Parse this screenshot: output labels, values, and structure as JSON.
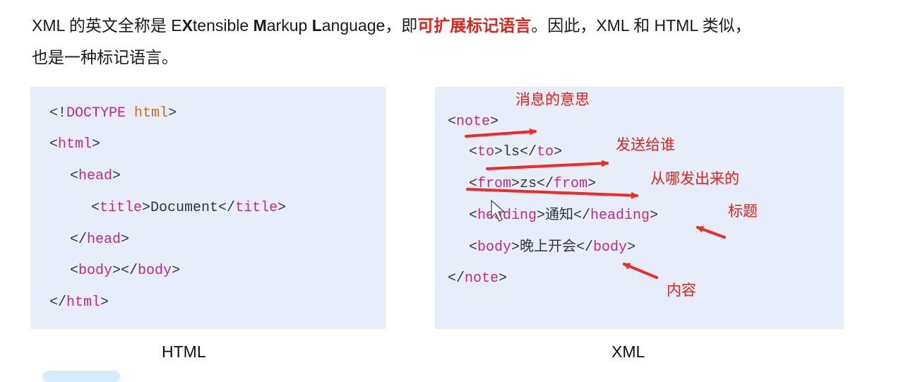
{
  "intro": {
    "p1": "XML 的英文全称是 E",
    "p2": "X",
    "p3": "tensible ",
    "p4": "M",
    "p5": "arkup ",
    "p6": "L",
    "p7": "anguage，即",
    "highlight": "可扩展标记语言",
    "p8": "。因此，XML 和 HTML 类似，",
    "line2": "也是一种标记语言。"
  },
  "html_code": {
    "l1a": "<!",
    "l1b": "DOCTYPE",
    "l1c": " ",
    "l1d": "html",
    "l1e": ">",
    "l2a": "<",
    "l2b": "html",
    "l2c": ">",
    "l3a": "<",
    "l3b": "head",
    "l3c": ">",
    "l4a": "<",
    "l4b": "title",
    "l4c": ">Document</",
    "l4d": "title",
    "l4e": ">",
    "l5a": "</",
    "l5b": "head",
    "l5c": ">",
    "l6a": "<",
    "l6b": "body",
    "l6c": "></",
    "l6d": "body",
    "l6e": ">",
    "l7a": "</",
    "l7b": "html",
    "l7c": ">"
  },
  "xml_code": {
    "l1a": "<",
    "l1b": "note",
    "l1c": ">",
    "l2a": "<",
    "l2b": "to",
    "l2c": ">ls</",
    "l2d": "to",
    "l2e": ">",
    "l3a": "<",
    "l3b": "from",
    "l3c": ">zs</",
    "l3d": "from",
    "l3e": ">",
    "l4a": "<",
    "l4b": "heading",
    "l4c": ">通知</",
    "l4d": "heading",
    "l4e": ">",
    "l5a": "<",
    "l5b": "body",
    "l5c": ">晚上开会</",
    "l5d": "body",
    "l5e": ">",
    "l6a": "</",
    "l6b": "note",
    "l6c": ">"
  },
  "annotations": {
    "note": "消息的意思",
    "to": "发送给谁",
    "from": "从哪发出来的",
    "heading": "标题",
    "body": "内容"
  },
  "captions": {
    "html": "HTML",
    "xml": "XML"
  },
  "colors": {
    "tag": "#c02a8a",
    "doctype": "#d2691e",
    "annotation": "#e0241a",
    "panel": "#e8eef9"
  }
}
